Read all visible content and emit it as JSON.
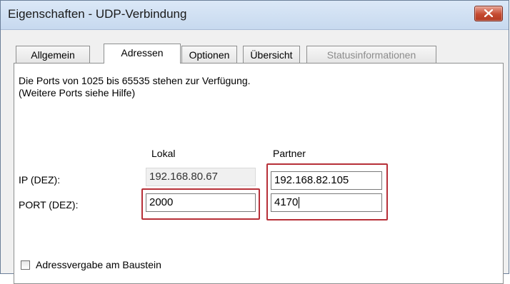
{
  "window": {
    "title": "Eigenschaften - UDP-Verbindung"
  },
  "tabs": [
    {
      "label": "Allgemein",
      "state": "inactive"
    },
    {
      "label": "Adressen",
      "state": "active"
    },
    {
      "label": "Optionen",
      "state": "inactive"
    },
    {
      "label": "Übersicht",
      "state": "inactive"
    },
    {
      "label": "Statusinformationen",
      "state": "disabled"
    }
  ],
  "info": {
    "line1": "Die Ports von 1025 bis 65535 stehen zur Verfügung.",
    "line2": "(Weitere Ports siehe Hilfe)"
  },
  "columns": {
    "local": "Lokal",
    "partner": "Partner"
  },
  "rows": {
    "ip_label": "IP (DEZ):",
    "port_label": "PORT (DEZ):"
  },
  "values": {
    "local_ip": "192.168.80.67",
    "local_port": "2000",
    "partner_ip": "192.168.82.105",
    "partner_port": "4170"
  },
  "checkbox": {
    "label": "Adressvergabe am Baustein",
    "checked": false
  },
  "colors": {
    "highlight": "#b73038",
    "close_button": "#c54a31"
  }
}
